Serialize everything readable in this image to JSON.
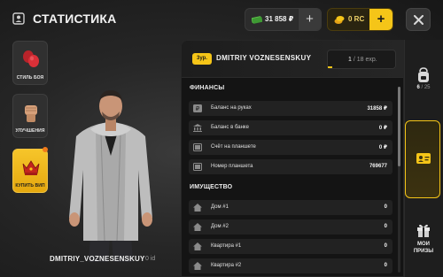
{
  "header": {
    "title": "СТАТИСТИКА",
    "money": "31 858 ₽",
    "rc": "0 RC",
    "plus_symbol": "+"
  },
  "menu": [
    {
      "label": "СТИЛЬ БОЯ",
      "icon": "boxing-gloves-icon"
    },
    {
      "label": "УЛУЧШЕНИЯ",
      "icon": "fist-icon"
    },
    {
      "label": "КУПИТЬ ВИП",
      "icon": "crown-icon"
    }
  ],
  "player": {
    "name": "DMITRIY_VOZNESENSKUY",
    "id": "0 id"
  },
  "panel": {
    "level": "3ур.",
    "name": "DMITRIY VOZNESENSKUY",
    "exp_current": "1",
    "exp_total": " / 18 exp.",
    "exp_progress": 0.06
  },
  "finances": {
    "title": "ФИНАНСЫ",
    "rows": [
      {
        "label": "Баланс на руках",
        "value": "31858 ₽",
        "icon": "ruble-icon"
      },
      {
        "label": "Баланс в банке",
        "value": "0 ₽",
        "icon": "bank-icon"
      },
      {
        "label": "Счёт на планшете",
        "value": "0 ₽",
        "icon": "tablet-icon"
      },
      {
        "label": "Номер планшета",
        "value": "769677",
        "icon": "tablet-icon"
      }
    ]
  },
  "property": {
    "title": "ИМУЩЕСТВО",
    "rows": [
      {
        "label": "Дом #1",
        "value": "0",
        "icon": "house-icon"
      },
      {
        "label": "Дом #2",
        "value": "0",
        "icon": "house-icon"
      },
      {
        "label": "Квартира #1",
        "value": "0",
        "icon": "house-icon"
      },
      {
        "label": "Квартира #2",
        "value": "0",
        "icon": "house-icon"
      }
    ]
  },
  "rail": {
    "inventory_current": "6",
    "inventory_total": " / 25",
    "prizes_line1": "МОИ",
    "prizes_line2": "ПРИЗЫ"
  },
  "colors": {
    "accent": "#f5c518",
    "money_green": "#5cc04a",
    "notification": "#f07a1a"
  }
}
